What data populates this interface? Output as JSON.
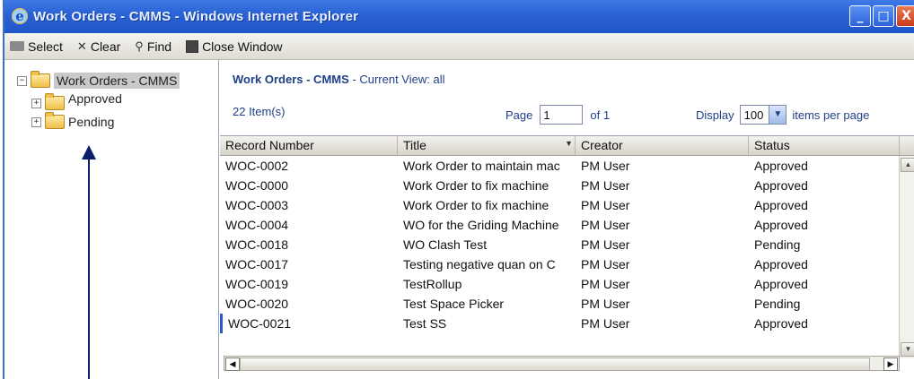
{
  "window": {
    "title": "Work Orders - CMMS - Windows Internet Explorer"
  },
  "toolbar": {
    "select_label": "Select",
    "clear_label": "Clear",
    "find_label": "Find",
    "close_label": "Close Window"
  },
  "tree": {
    "root": "Work Orders - CMMS",
    "children": [
      {
        "label": "Approved"
      },
      {
        "label": "Pending"
      }
    ]
  },
  "header": {
    "title": "Work Orders - CMMS",
    "view_text": " - Current View:  all",
    "item_count": "22 Item(s)"
  },
  "pager": {
    "page_label": "Page",
    "page_value": "1",
    "of_label": "of 1",
    "display_label": "Display",
    "display_value": "100",
    "per_page_label": "items per page"
  },
  "grid": {
    "columns": [
      "Record Number",
      "Title",
      "Creator",
      "Status"
    ],
    "rows": [
      [
        "WOC-0002",
        "Work Order to maintain mac",
        "PM User",
        "Approved"
      ],
      [
        "WOC-0000",
        "Work Order to fix machine",
        "PM User",
        "Approved"
      ],
      [
        "WOC-0003",
        "Work Order to fix machine",
        "PM User",
        "Approved"
      ],
      [
        "WOC-0004",
        "WO for the Griding Machine",
        "PM User",
        "Approved"
      ],
      [
        "WOC-0018",
        "WO Clash Test",
        "PM User",
        "Pending"
      ],
      [
        "WOC-0017",
        "Testing negative quan on C",
        "PM User",
        "Approved"
      ],
      [
        "WOC-0019",
        "TestRollup",
        "PM User",
        "Approved"
      ],
      [
        "WOC-0020",
        "Test Space Picker",
        "PM User",
        "Pending"
      ],
      [
        "WOC-0021",
        "Test SS",
        "PM User",
        "Approved"
      ]
    ]
  },
  "colors": {
    "titlebar": "#2b63d6",
    "link": "#1f3f86",
    "annotation_arrow": "#0a1d6b"
  }
}
